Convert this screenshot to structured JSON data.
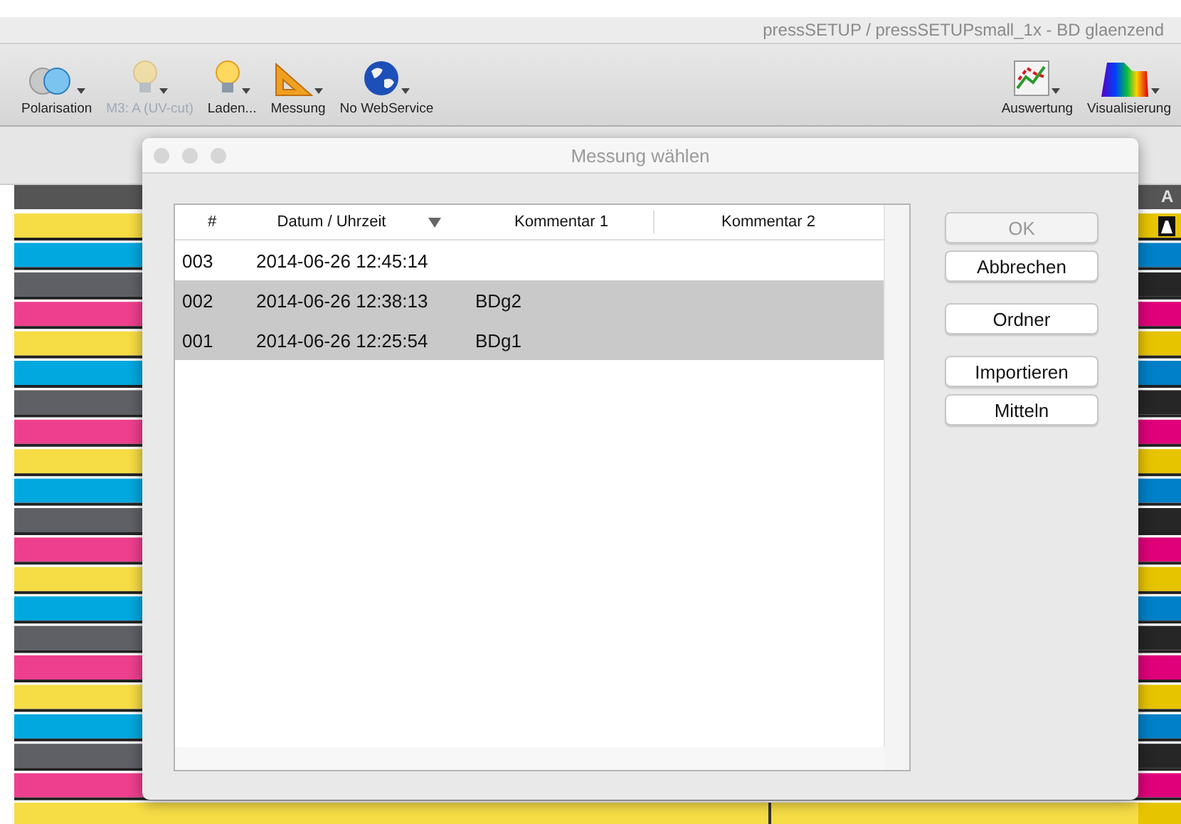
{
  "window": {
    "title": "pressSETUP / pressSETUPsmall_1x - BD glaenzend"
  },
  "toolbar": {
    "left": [
      {
        "kind": "polarisation",
        "label": "Polarisation",
        "disabled": false
      },
      {
        "kind": "bulb",
        "label": "M3: A (UV-cut)",
        "disabled": true
      },
      {
        "kind": "bulb",
        "label": "Laden...",
        "disabled": false
      },
      {
        "kind": "ruler",
        "label": "Messung",
        "disabled": false
      },
      {
        "kind": "globe",
        "label": "No WebService",
        "disabled": false
      }
    ],
    "right": [
      {
        "kind": "chart",
        "label": "Auswertung",
        "disabled": false
      },
      {
        "kind": "spectrum",
        "label": "Visualisierung",
        "disabled": false
      }
    ]
  },
  "column_header": "A",
  "dialog": {
    "title": "Messung wählen",
    "columns": [
      {
        "label": "#",
        "sorted": false
      },
      {
        "label": "Datum / Uhrzeit",
        "sorted": true
      },
      {
        "label": "Kommentar 1",
        "sorted": false
      },
      {
        "label": "Kommentar 2",
        "sorted": false
      }
    ],
    "rows": [
      {
        "number": "003",
        "datetime": "2014-06-26 12:45:14",
        "comment_1": "",
        "selected": false
      },
      {
        "number": "002",
        "datetime": "2014-06-26 12:38:13",
        "comment_1": "BDg2",
        "selected": true
      },
      {
        "number": "001",
        "datetime": "2014-06-26 12:25:54",
        "comment_1": "BDg1",
        "selected": true
      }
    ],
    "button_groups": [
      [
        {
          "label": "OK",
          "disabled": true
        },
        {
          "label": "Abbrechen",
          "disabled": false
        }
      ],
      [
        {
          "label": "Ordner",
          "disabled": false
        }
      ],
      [
        {
          "label": "Importieren",
          "disabled": false
        },
        {
          "label": "Mitteln",
          "disabled": false
        }
      ]
    ]
  }
}
